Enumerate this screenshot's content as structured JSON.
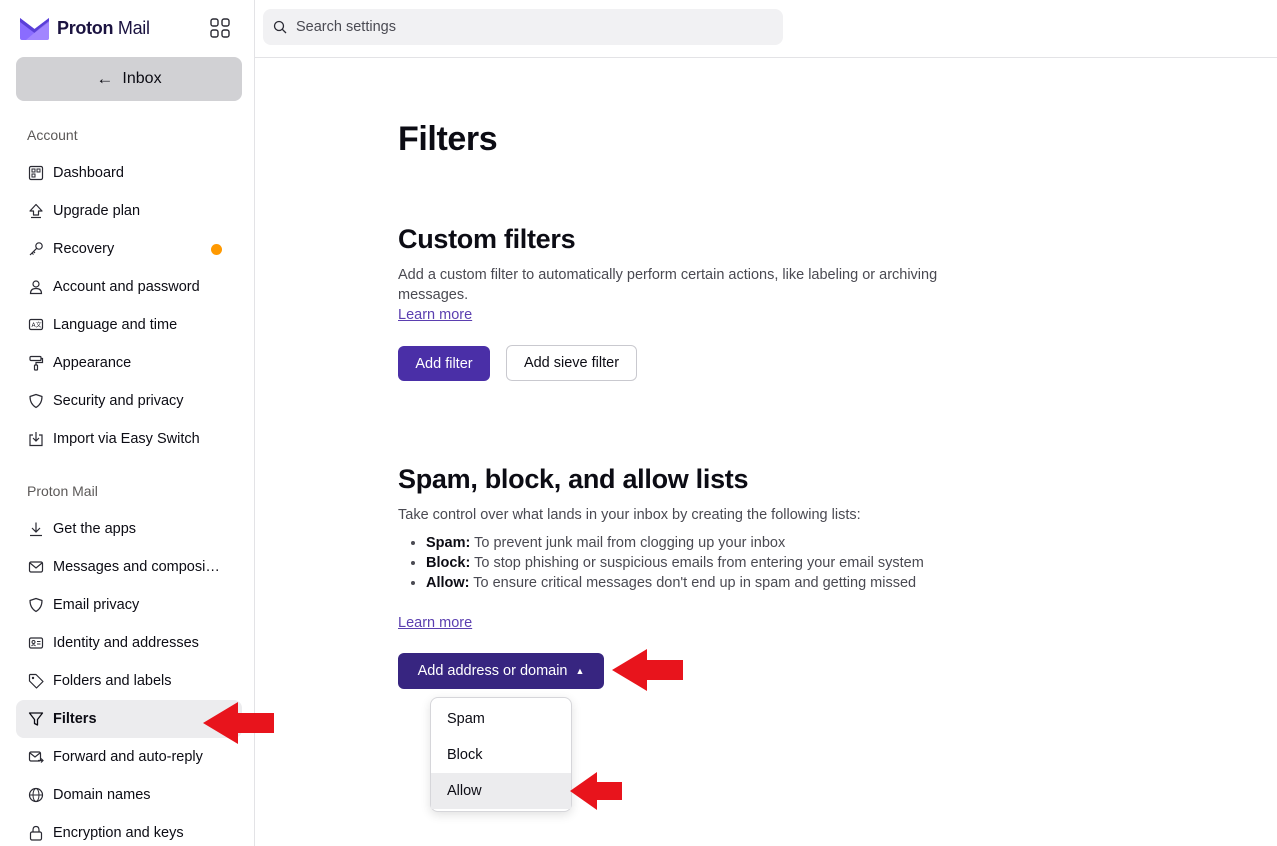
{
  "app": {
    "brand_main": "Proton",
    "brand_sub": "Mail",
    "inbox_label": "Inbox",
    "search_placeholder": "Search settings"
  },
  "sidebar": {
    "account_section": "Account",
    "account_items": [
      {
        "label": "Dashboard",
        "icon": "dashboard-icon"
      },
      {
        "label": "Upgrade plan",
        "icon": "upgrade-icon"
      },
      {
        "label": "Recovery",
        "icon": "key-icon",
        "badge_color": "#ff9900"
      },
      {
        "label": "Account and password",
        "icon": "user-icon"
      },
      {
        "label": "Language and time",
        "icon": "language-icon"
      },
      {
        "label": "Appearance",
        "icon": "paint-roller-icon"
      },
      {
        "label": "Security and privacy",
        "icon": "shield-icon"
      },
      {
        "label": "Import via Easy Switch",
        "icon": "import-icon"
      }
    ],
    "mail_section": "Proton Mail",
    "mail_items": [
      {
        "label": "Get the apps",
        "icon": "download-icon"
      },
      {
        "label": "Messages and composi…",
        "icon": "envelope-icon"
      },
      {
        "label": "Email privacy",
        "icon": "shield-icon"
      },
      {
        "label": "Identity and addresses",
        "icon": "id-card-icon"
      },
      {
        "label": "Folders and labels",
        "icon": "tag-icon"
      },
      {
        "label": "Filters",
        "icon": "filter-icon",
        "active": true
      },
      {
        "label": "Forward and auto-reply",
        "icon": "forward-icon"
      },
      {
        "label": "Domain names",
        "icon": "globe-icon"
      },
      {
        "label": "Encryption and keys",
        "icon": "lock-icon"
      }
    ]
  },
  "main": {
    "title": "Filters",
    "custom": {
      "heading": "Custom filters",
      "description": "Add a custom filter to automatically perform certain actions, like labeling or archiving messages.",
      "learn_more": "Learn more",
      "add_filter": "Add filter",
      "add_sieve": "Add sieve filter"
    },
    "lists": {
      "heading": "Spam, block, and allow lists",
      "description": "Take control over what lands in your inbox by creating the following lists:",
      "items": [
        {
          "term": "Spam:",
          "text": " To prevent junk mail from clogging up your inbox"
        },
        {
          "term": "Block:",
          "text": " To stop phishing or suspicious emails from entering your email system"
        },
        {
          "term": "Allow:",
          "text": " To ensure critical messages don't end up in spam and getting missed"
        }
      ],
      "learn_more": "Learn more",
      "add_button": "Add address or domain",
      "dropdown": [
        "Spam",
        "Block",
        "Allow"
      ]
    }
  },
  "colors": {
    "primary": "#4a2fa7",
    "annotation_arrow": "#e8141c",
    "brand": "#6d4aff"
  }
}
